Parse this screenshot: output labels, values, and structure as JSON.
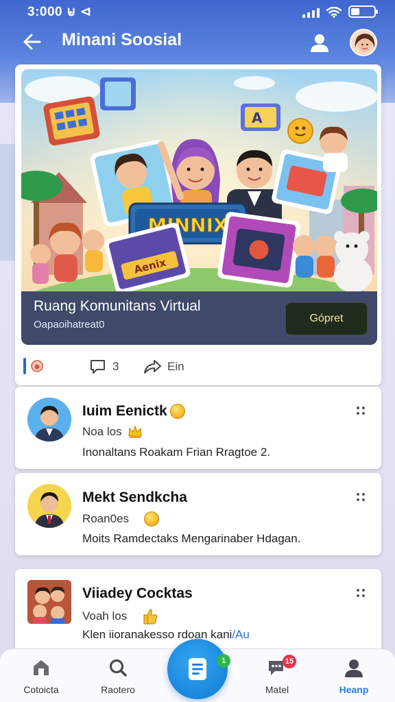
{
  "status_bar": {
    "time": "3:000 ⊌ ⊲"
  },
  "header": {
    "title": "Minani Soosial"
  },
  "featured": {
    "banner_logo": "MINNIX",
    "banner_sign": "Aenix",
    "title": "Ruang Komunitans Virtual",
    "subtitle": "Oapaoihatreat0",
    "cta_label": "Gópret",
    "comments_count": "3",
    "share_label": "Ein"
  },
  "posts": [
    {
      "name": "Iuim Eenictk",
      "meta": "Noa los",
      "body": "Inonaltans Roakam Frian Rragtoe 2."
    },
    {
      "name": "Mekt Sendkcha",
      "meta": "Roan0es",
      "body": "Moits Ramdectaks Mengarinaber Hdagan."
    },
    {
      "name": "Viiadey Cocktas",
      "meta": "Voah los",
      "body": "Klen iioranakesso  rdoan kani",
      "body_tag": "/Au"
    }
  ],
  "bottom_nav": {
    "items": [
      {
        "label": "Cotoicta"
      },
      {
        "label": "Raotero"
      },
      {
        "label": "Matel",
        "badge": "15"
      },
      {
        "label": "Heanp"
      }
    ],
    "fab_badge": "1",
    "active_index": 3
  },
  "colors": {
    "accent": "#1a86dc",
    "header": "#4a70d4",
    "active_nav": "#2a7de1"
  }
}
